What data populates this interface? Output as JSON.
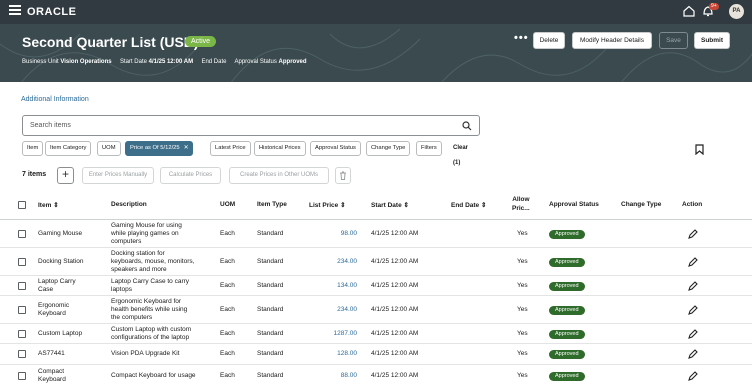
{
  "topbar": {
    "logo": "ORACLE",
    "notification_count": "9+",
    "avatar_initials": "PA"
  },
  "header": {
    "title": "Second Quarter List (USD)",
    "status": "Active",
    "business_unit_label": "Business Unit",
    "business_unit_value": "Vision Operations",
    "start_date_label": "Start Date",
    "start_date_value": "4/1/25 12:00 AM",
    "end_date_label": "End Date",
    "approval_status_label": "Approval Status",
    "approval_status_value": "Approved",
    "more": "•••",
    "delete_label": "Delete",
    "modify_label": "Modify Header Details",
    "save_label": "Save",
    "submit_label": "Submit"
  },
  "additional_info": "Additional Information",
  "search": {
    "placeholder": "Search items"
  },
  "filters": {
    "chips": [
      "Item",
      "Item Category",
      "UOM",
      "Price as Of 5/12/25",
      "Latest Price",
      "Historical Prices",
      "Approval Status",
      "Change Type",
      "Filters"
    ],
    "active_index": 3,
    "clear_label": "Clear (1)"
  },
  "toolbar": {
    "count": "7 items",
    "add": "+",
    "enter_prices": "Enter Prices Manually",
    "calculate": "Calculate Prices",
    "create_other": "Create Prices in Other UOMs"
  },
  "table": {
    "columns": {
      "item": "Item",
      "description": "Description",
      "uom": "UOM",
      "item_type": "Item Type",
      "list_price": "List Price",
      "start_date": "Start Date",
      "end_date": "End Date",
      "allow_line1": "Allow",
      "allow_line2": "Pric...",
      "approval_status": "Approval Status",
      "change_type": "Change Type",
      "action": "Action"
    },
    "rows": [
      {
        "item": "Gaming Mouse",
        "item2": "",
        "d1": "Gaming Mouse for using",
        "d2": "while playing games on",
        "d3": "computers",
        "d4": "",
        "uom": "Each",
        "type": "Standard",
        "price": "98.00",
        "start": "4/1/25 12:00 AM",
        "allow": "Yes",
        "approval": "Approved"
      },
      {
        "item": "Docking Station",
        "item2": "",
        "d1": "Docking station for",
        "d2": "keyboards, mouse, monitors,",
        "d3": "speakers and more",
        "d4": "",
        "uom": "Each",
        "type": "Standard",
        "price": "234.00",
        "start": "4/1/25 12:00 AM",
        "allow": "Yes",
        "approval": "Approved"
      },
      {
        "item": "Laptop Carry",
        "item2": "Case",
        "d1": "Laptop Carry Case to carry",
        "d2": "laptops",
        "d3": "",
        "d4": "",
        "uom": "Each",
        "type": "Standard",
        "price": "134.00",
        "start": "4/1/25 12:00 AM",
        "allow": "Yes",
        "approval": "Approved"
      },
      {
        "item": "Ergonomic",
        "item2": "Keyboard",
        "d1": "Ergonomic Keyboard for",
        "d2": "health benefits while using",
        "d3": "the computers",
        "d4": "",
        "uom": "Each",
        "type": "Standard",
        "price": "234.00",
        "start": "4/1/25 12:00 AM",
        "allow": "Yes",
        "approval": "Approved"
      },
      {
        "item": "Custom Laptop",
        "item2": "",
        "d1": "Custom Laptop with custom",
        "d2": "configurations of the laptop",
        "d3": "",
        "d4": "",
        "uom": "Each",
        "type": "Standard",
        "price": "1287.00",
        "start": "4/1/25 12:00 AM",
        "allow": "Yes",
        "approval": "Approved"
      },
      {
        "item": "AS77441",
        "item2": "",
        "d1": "Vision PDA Upgrade Kit",
        "d2": "",
        "d3": "",
        "d4": "",
        "uom": "Each",
        "type": "Standard",
        "price": "128.00",
        "start": "4/1/25 12:00 AM",
        "allow": "Yes",
        "approval": "Approved"
      },
      {
        "item": "Compact",
        "item2": "Keyboard",
        "d1": "Compact Keyboard for usage",
        "d2": "",
        "d3": "",
        "d4": "",
        "uom": "Each",
        "type": "Standard",
        "price": "88.00",
        "start": "4/1/25 12:00 AM",
        "allow": "Yes",
        "approval": "Approved"
      }
    ]
  },
  "colors": {
    "topbar": "#313a40",
    "header": "#3b4a4f",
    "active_chip": "#7ab648",
    "approved": "#2f6b2a",
    "link": "#2a6a99",
    "filter_active": "#3e6f8a"
  }
}
